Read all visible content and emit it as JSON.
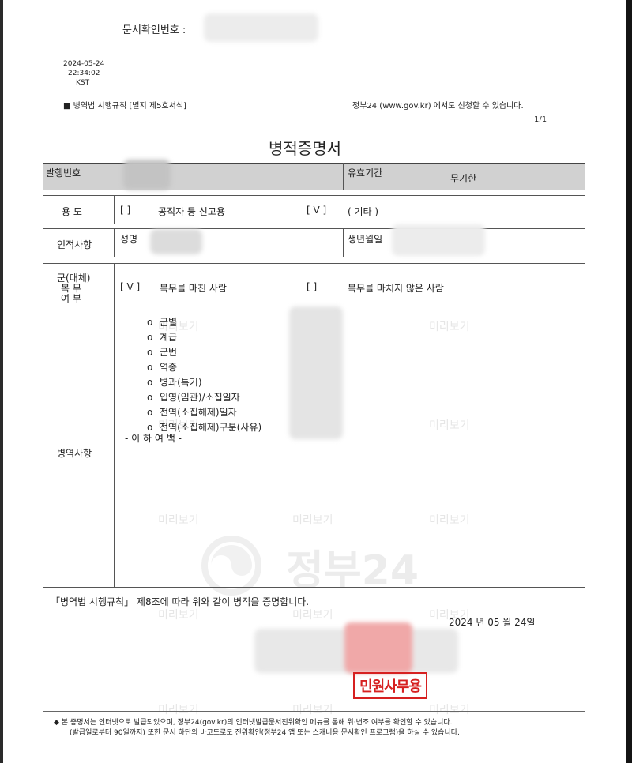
{
  "header": {
    "doc_check_label": "문서확인번호  :",
    "print_date": "2024-05-24",
    "print_time": "22:34:02",
    "print_tz": "KST",
    "rule_ref": "■  병역법 시행규칙 [별지 제5호서식]",
    "gov_notice": "정부24 (www.gov.kr) 에서도 신청할 수 있습니다.",
    "page_number": "1/1"
  },
  "title": "병적증명서",
  "issue": {
    "issue_no_label": "발행번호",
    "validity_label": "유효기간",
    "validity_value": "무기한"
  },
  "purpose": {
    "label": "용     도",
    "option1_bracket": "[        ]",
    "option1_text": "공직자 등 신고용",
    "option2_bracket": "[   V   ]",
    "option2_text": "( 기타 )"
  },
  "identity": {
    "label": "인적사항",
    "name_label": "성명",
    "birth_label": "생년월일"
  },
  "service": {
    "label_line1": "군(대체)",
    "label_line2": "복     무",
    "label_line3": "여     부",
    "option1_bracket": "[   V   ]",
    "option1_text": "복무를 마친 사람",
    "option2_bracket": "[        ]",
    "option2_text": "복무를 마치지 않은 사람"
  },
  "military": {
    "label": "병역사항",
    "items": [
      "군별",
      "계급",
      "군번",
      "역종",
      "병과(특기)",
      "입영(임관)/소집일자",
      "전역(소집해제)일자",
      "전역(소집해제)구분(사유)"
    ],
    "end_mark": "- 이 하 여 백 -"
  },
  "certification": {
    "statement": "「병역법 시행규칙」 제8조에 따라 위와 같이 병적을 증명합니다.",
    "date": "2024 년 05 월 24일"
  },
  "seal_text": "민원사무용",
  "watermark": {
    "preview": "미리보기",
    "logo_text": "정부24"
  },
  "footer": {
    "line1": "◆  본 증명서는 인터넷으로 발급되었으며, 정부24(gov.kr)의 인터넷발급문서진위확인 메뉴를 통해 위·변조 여부를 확인할 수 있습니다.",
    "line2": "(발급일로부터 90일까지) 또한 문서 하단의 바코드로도 진위확인(정부24 앱 또는 스캐너용 문서확인 프로그램)을 하실 수 있습니다."
  }
}
